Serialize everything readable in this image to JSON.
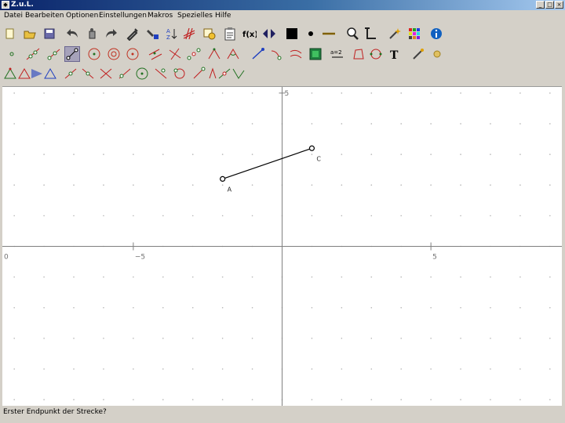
{
  "window": {
    "title": "Z.u.L.",
    "controls": [
      "_",
      "□",
      "×"
    ]
  },
  "menu": [
    "Datei",
    "Bearbeiten",
    "Optionen",
    "Einstellungen",
    "Makros",
    "Spezielles",
    "Hilfe"
  ],
  "toolbar_rows": [
    [
      "new-file",
      "open-file",
      "save-file",
      "undo",
      "delete",
      "redo",
      "edit-tool",
      "color-tool",
      "sort-tool",
      "grid-hide",
      "copy-tool",
      "clipboard",
      "function",
      "arrows-lr",
      "black-square",
      "point-style",
      "line-style",
      "zoom-tool",
      "axes-tool",
      "magic-wand",
      "color-palette",
      "info"
    ],
    [
      "point",
      "line-two-points",
      "ray",
      "segment",
      "circle",
      "circle-fixed",
      "circle-three-points",
      "parallel",
      "perpendicular",
      "midpoint",
      "angle",
      "angle-fixed",
      "move",
      "trace",
      "animate",
      "film",
      "expression",
      "polygon",
      "conic",
      "text",
      "hide-tool",
      "label-tool"
    ],
    [
      "tri-1",
      "tri-2",
      "tri-3",
      "tri-4",
      "tri-5",
      "tri-6",
      "tri-7",
      "tri-8",
      "circle-op",
      "reflect-1",
      "reflect-2",
      "rotate-1",
      "rotate-2",
      "translate-1",
      "translate-2"
    ]
  ],
  "active_tool": "segment",
  "graph": {
    "x_range": [
      -9.4,
      9.4
    ],
    "y_range": [
      -5.2,
      5.2
    ],
    "x_ticks": [
      {
        "value": -5,
        "label": "−5"
      },
      {
        "value": 5,
        "label": "5"
      }
    ],
    "y_ticks": [
      {
        "value": 5,
        "label": "5"
      }
    ],
    "left_label": "0",
    "points": [
      {
        "name": "A",
        "x": -2.0,
        "y": 2.2,
        "label": "A"
      },
      {
        "name": "C",
        "x": 1.0,
        "y": 3.2,
        "label": "C"
      }
    ],
    "segment": [
      "A",
      "C"
    ],
    "colors": {
      "grid": "#b4b4b4",
      "axis": "#808080",
      "segment": "#000000"
    }
  },
  "status": "Erster Endpunkt der Strecke?"
}
